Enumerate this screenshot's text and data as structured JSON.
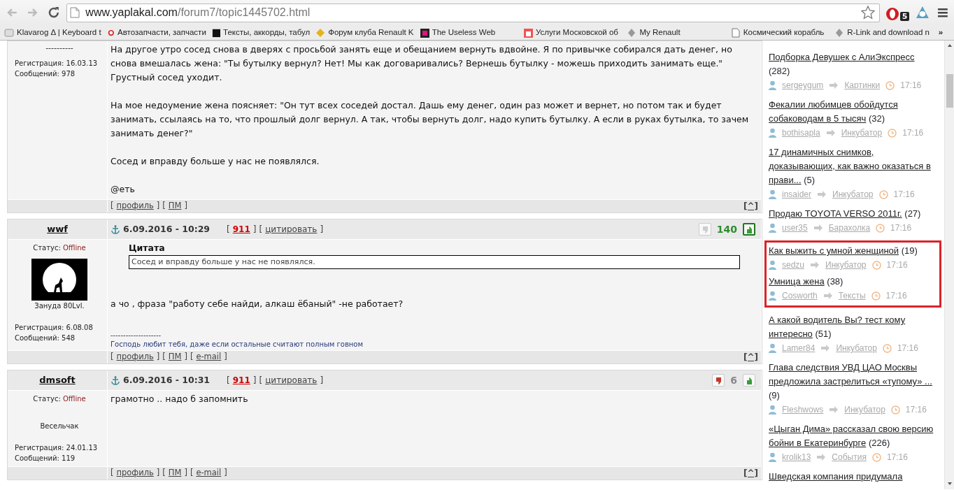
{
  "browser": {
    "url_host": "www.yaplakal.com",
    "url_path": "/forum7/topic1445702.html",
    "extension_badge": "5",
    "bookmarks": [
      {
        "label": "Klavarog Δ | Keyboard t"
      },
      {
        "label": "Автозапчасти, запчасти"
      },
      {
        "label": "Тексты, аккорды, табул"
      },
      {
        "label": "Форум клуба Renault K"
      },
      {
        "label": "The Useless Web"
      },
      {
        "label": "Услуги Московской об"
      },
      {
        "label": "My Renault"
      },
      {
        "label": "Космический корабль"
      },
      {
        "label": "R-Link and download n"
      }
    ],
    "overflow": "»"
  },
  "posts": [
    {
      "user": {
        "rank": "----------",
        "registration": "Регистрация: 16.03.13",
        "messages": "Сообщений: 978"
      },
      "paragraphs": [
        "На другое утро сосед снова в дверях с просьбой занять еще и обещанием вернуть вдвойне. Я по привычке собирался дать денег, но снова вмешалась жена: \"Ты бутылку вернул? Нет! Мы как договаривались? Вернешь бутылку - можешь приходить занимать еще.\" Грустный сосед уходит.",
        "На мое недоумение жена поясняет: \"Он тут всех соседей достал. Дашь ему денег, один раз может и вернет, но потом так и будет занимать, ссылаясь на то, что прошлый долг вернул. А так, чтобы вернуть долг, надо купить бутылку. А если в руках бутылка, то зачем занимать денег?\"",
        "Сосед и вправду больше у нас не появлялся.",
        "@еть"
      ],
      "footer_links": [
        {
          "open": "[",
          "label": "профиль",
          "close": "]"
        },
        {
          "open": "[",
          "label": "ПМ",
          "close": "]"
        }
      ],
      "top_link": "[^]"
    },
    {
      "author": "wwf",
      "date": "6.09.2016 - 10:29",
      "header_links": [
        {
          "open": "[",
          "label": "911",
          "kind": "count",
          "close": "]"
        },
        {
          "open": "[",
          "label": "цитировать",
          "kind": "action",
          "close": "]"
        }
      ],
      "rating": {
        "value": "140",
        "kind": "positive",
        "voted_up": true
      },
      "user": {
        "status_label": "Статус:",
        "status": "Offline",
        "has_avatar": true,
        "rank": "Зануда 80Lvl.",
        "registration": "Регистрация: 6.08.08",
        "messages": "Сообщений: 548"
      },
      "quote": {
        "label": "Цитата",
        "text": "Сосед и вправду больше у нас не появлялся."
      },
      "paragraphs": [
        "а чо , фраза \"работу себе найди, алкаш ёбаный\" -не работает?"
      ],
      "signature": {
        "rule": "--------------------",
        "text": "Господь любит тебя, даже если остальные считают полным говном"
      },
      "footer_links": [
        {
          "open": "[",
          "label": "профиль",
          "close": "]"
        },
        {
          "open": "[",
          "label": "ПМ",
          "close": "]"
        },
        {
          "open": "[",
          "label": "e-mail",
          "close": "]"
        }
      ],
      "top_link": "[^]"
    },
    {
      "author": "dmsoft",
      "date": "6.09.2016 - 10:31",
      "header_links": [
        {
          "open": "[",
          "label": "911",
          "kind": "count",
          "close": "]"
        },
        {
          "open": "[",
          "label": "цитировать",
          "kind": "action",
          "close": "]"
        }
      ],
      "rating": {
        "value": "6",
        "kind": "neutral",
        "voted_up": false
      },
      "user": {
        "status_label": "Статус:",
        "status": "Offline",
        "has_avatar": false,
        "rank": "Весельчак",
        "registration": "Регистрация: 24.01.13",
        "messages": "Сообщений: 119"
      },
      "paragraphs": [
        "грамотно .. надо б запомнить"
      ],
      "footer_links": [
        {
          "open": "[",
          "label": "профиль",
          "close": "]"
        },
        {
          "open": "[",
          "label": "ПМ",
          "close": "]"
        },
        {
          "open": "[",
          "label": "e-mail",
          "close": "]"
        }
      ],
      "top_link": "[^]"
    }
  ],
  "sidebar": {
    "items": [
      {
        "title": "Подборка Девушек с АлиЭкспресс",
        "count": "(282)",
        "author": "sergeygum",
        "section": "Картинки",
        "time": "17:16",
        "highlighted": false
      },
      {
        "title": "Фекалии любимцев обойдутся собаководам в 5 тысяч",
        "count": "(32)",
        "author": "bothisapla",
        "section": "Инкубатор",
        "time": "17:16",
        "highlighted": false
      },
      {
        "title": "17 динамичных снимков, доказывающих, как важно оказаться в прави...",
        "count": "(5)",
        "author": "insaider",
        "section": "Инкубатор",
        "time": "17:16",
        "highlighted": false
      },
      {
        "title": "Продаю TOYOTA VERSO 2011г.",
        "count": "(27)",
        "author": "user35",
        "section": "Барахолка",
        "time": "17:16",
        "highlighted": false
      },
      {
        "title": "Как выжить с умной женщиной",
        "count": "(19)",
        "author": "sedzu",
        "section": "Инкубатор",
        "time": "17:16",
        "highlighted": true
      },
      {
        "title": "Умница жена",
        "count": "(38)",
        "author": "Cosworth",
        "section": "Тексты",
        "time": "17:16",
        "highlighted": true
      },
      {
        "title": "А какой водитель Вы? тест кому интересно",
        "count": "(51)",
        "author": "Lamer84",
        "section": "Инкубатор",
        "time": "17:16",
        "highlighted": false
      },
      {
        "title": "Глава следствия УВД ЦАО Москвы предложила застрелиться «тупому» ...",
        "count": "(9)",
        "author": "Fleshwows",
        "section": "Инкубатор",
        "time": "17:16",
        "highlighted": false
      },
      {
        "title": "«Цыган Дима» рассказал свою версию бойни в Екатеринбурге",
        "count": "(226)",
        "author": "krolik13",
        "section": "События",
        "time": "17:16",
        "highlighted": false
      },
      {
        "title": "Шведская компания придумала",
        "highlighted": false
      }
    ]
  }
}
